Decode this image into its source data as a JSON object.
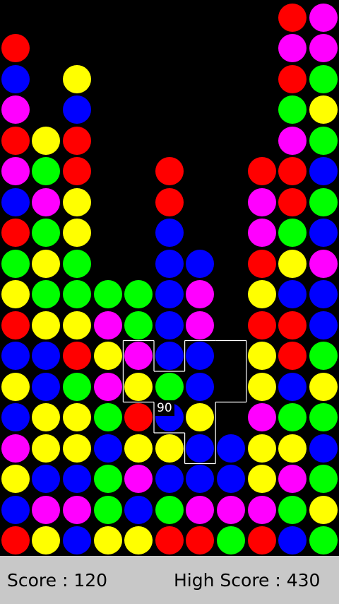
{
  "colors": {
    "R": "#ff0000",
    "Y": "#ffff00",
    "B": "#0000ff",
    "G": "#00ff00",
    "M": "#ff00ff",
    "background": "#000000",
    "status_bar": "#c8c8c8",
    "selection_outline": "#ffffff"
  },
  "board": {
    "columns": [
      [
        "R",
        "B",
        "Y",
        "M",
        "B",
        "Y",
        "B",
        "R",
        "Y",
        "G",
        "R",
        "B",
        "M",
        "R",
        "M",
        "B",
        "R"
      ],
      [
        "Y",
        "M",
        "B",
        "Y",
        "Y",
        "B",
        "B",
        "Y",
        "G",
        "Y",
        "G",
        "M",
        "G",
        "Y"
      ],
      [
        "B",
        "M",
        "B",
        "Y",
        "Y",
        "G",
        "R",
        "Y",
        "G",
        "G",
        "Y",
        "Y",
        "R",
        "R",
        "B",
        "Y"
      ],
      [
        "Y",
        "G",
        "G",
        "B",
        "G",
        "M",
        "Y",
        "M",
        "G"
      ],
      [
        "Y",
        "B",
        "M",
        "Y",
        "R",
        "Y",
        "M",
        "G",
        "G"
      ],
      [
        "R",
        "G",
        "B",
        "Y",
        "B",
        "G",
        "B",
        "B",
        "B",
        "B",
        "B",
        "R",
        "R"
      ],
      [
        "R",
        "M",
        "B",
        "B",
        "Y",
        "B",
        "B",
        "M",
        "M",
        "B"
      ],
      [
        "G",
        "M",
        "B",
        "B"
      ],
      [
        "R",
        "M",
        "Y",
        "Y",
        "M",
        "Y",
        "Y",
        "R",
        "Y",
        "R",
        "M",
        "M",
        "R"
      ],
      [
        "B",
        "G",
        "M",
        "Y",
        "G",
        "B",
        "R",
        "R",
        "B",
        "Y",
        "G",
        "R",
        "R",
        "M",
        "G",
        "R",
        "M",
        "R"
      ],
      [
        "G",
        "Y",
        "G",
        "B",
        "G",
        "Y",
        "G",
        "B",
        "B",
        "M",
        "B",
        "G",
        "B",
        "G",
        "Y",
        "G",
        "M",
        "M"
      ]
    ]
  },
  "selection": {
    "label": "90",
    "cells": [
      [
        6,
        3
      ],
      [
        6,
        4
      ],
      [
        6,
        5
      ],
      [
        6,
        6
      ],
      [
        5,
        4
      ],
      [
        5,
        5
      ],
      [
        7,
        5
      ],
      [
        7,
        6
      ],
      [
        4,
        5
      ],
      [
        4,
        6
      ]
    ]
  },
  "status": {
    "score": "Score : 120",
    "high_score": "High Score : 430"
  }
}
